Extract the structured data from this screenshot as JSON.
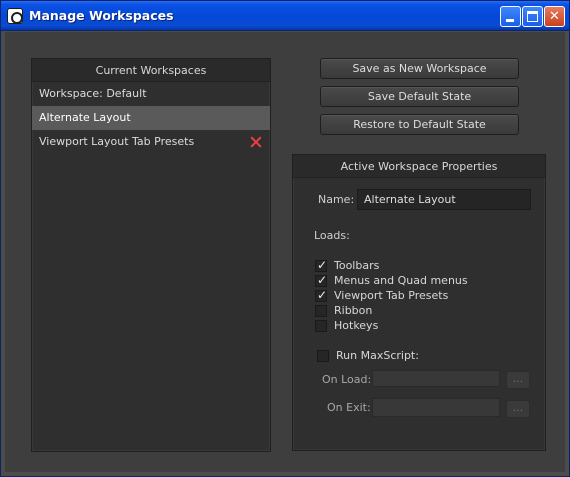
{
  "window": {
    "title": "Manage Workspaces"
  },
  "workspaces": {
    "header": "Current Workspaces",
    "items": [
      {
        "label": "Workspace: Default"
      },
      {
        "label": "Alternate Layout",
        "selected": true
      },
      {
        "label": "Viewport Layout Tab Presets",
        "removable": true
      }
    ]
  },
  "actions": {
    "save_new": "Save as New Workspace",
    "save_default": "Save Default State",
    "restore_default": "Restore to Default State"
  },
  "properties": {
    "header": "Active Workspace Properties",
    "name_label": "Name:",
    "name_value": "Alternate Layout",
    "loads_label": "Loads:",
    "loads": [
      {
        "label": "Toolbars",
        "checked": true
      },
      {
        "label": "Menus and Quad menus",
        "checked": true
      },
      {
        "label": "Viewport Tab Presets",
        "checked": true
      },
      {
        "label": "Ribbon",
        "checked": false
      },
      {
        "label": "Hotkeys",
        "checked": false
      }
    ],
    "run_maxscript_label": "Run MaxScript:",
    "run_maxscript_checked": false,
    "on_load_label": "On Load:",
    "on_load_value": "",
    "on_exit_label": "On Exit:",
    "on_exit_value": "",
    "browse_label": "..."
  }
}
